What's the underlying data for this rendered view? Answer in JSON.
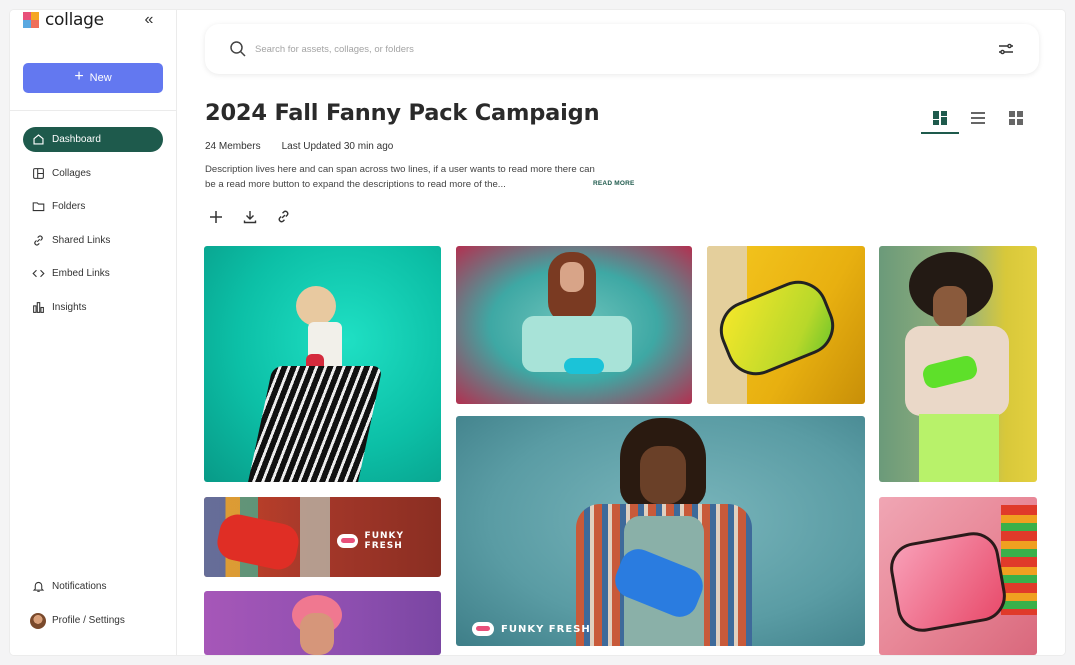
{
  "app": {
    "name": "collage"
  },
  "sidebar": {
    "new_label": "New",
    "items": [
      {
        "label": "Dashboard",
        "icon": "home-icon",
        "active": true
      },
      {
        "label": "Collages",
        "icon": "layout-icon",
        "active": false
      },
      {
        "label": "Folders",
        "icon": "folder-icon",
        "active": false
      },
      {
        "label": "Shared Links",
        "icon": "link-icon",
        "active": false
      },
      {
        "label": "Embed Links",
        "icon": "code-icon",
        "active": false
      },
      {
        "label": "Insights",
        "icon": "bar-chart-icon",
        "active": false
      }
    ],
    "bottom": [
      {
        "label": "Notifications",
        "icon": "bell-icon"
      },
      {
        "label": "Profile / Settings",
        "icon": "avatar"
      }
    ]
  },
  "search": {
    "placeholder": "Search for assets, collages, or folders"
  },
  "page": {
    "title": "2024 Fall Fanny Pack Campaign",
    "members": "24 Members",
    "last_updated": "Last Updated 30 min ago",
    "description": "Description lives here and can span across two lines, if a user wants to read more there can be a read more button to expand the descriptions to read more of the...",
    "read_more": "READ MORE"
  },
  "gallery": {
    "brand_text": "FUNKY FRESH"
  },
  "colors": {
    "accent": "#1e5a4c",
    "new_button": "#6378f0"
  }
}
